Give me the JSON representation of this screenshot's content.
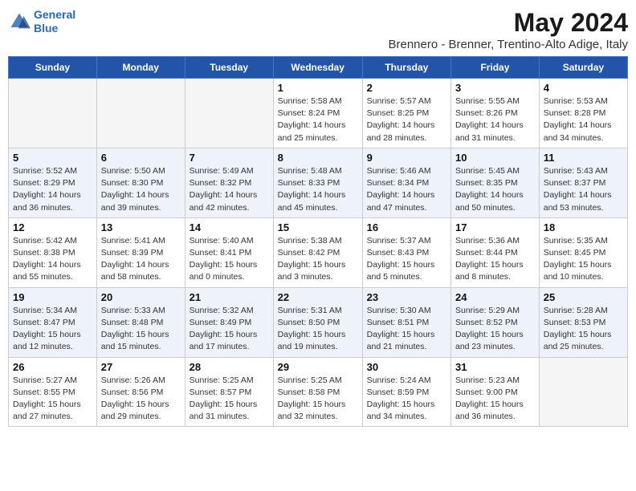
{
  "header": {
    "logo_line1": "General",
    "logo_line2": "Blue",
    "month_year": "May 2024",
    "location": "Brennero - Brenner, Trentino-Alto Adige, Italy"
  },
  "weekdays": [
    "Sunday",
    "Monday",
    "Tuesday",
    "Wednesday",
    "Thursday",
    "Friday",
    "Saturday"
  ],
  "weeks": [
    [
      {
        "day": "",
        "info": ""
      },
      {
        "day": "",
        "info": ""
      },
      {
        "day": "",
        "info": ""
      },
      {
        "day": "1",
        "info": "Sunrise: 5:58 AM\nSunset: 8:24 PM\nDaylight: 14 hours\nand 25 minutes."
      },
      {
        "day": "2",
        "info": "Sunrise: 5:57 AM\nSunset: 8:25 PM\nDaylight: 14 hours\nand 28 minutes."
      },
      {
        "day": "3",
        "info": "Sunrise: 5:55 AM\nSunset: 8:26 PM\nDaylight: 14 hours\nand 31 minutes."
      },
      {
        "day": "4",
        "info": "Sunrise: 5:53 AM\nSunset: 8:28 PM\nDaylight: 14 hours\nand 34 minutes."
      }
    ],
    [
      {
        "day": "5",
        "info": "Sunrise: 5:52 AM\nSunset: 8:29 PM\nDaylight: 14 hours\nand 36 minutes."
      },
      {
        "day": "6",
        "info": "Sunrise: 5:50 AM\nSunset: 8:30 PM\nDaylight: 14 hours\nand 39 minutes."
      },
      {
        "day": "7",
        "info": "Sunrise: 5:49 AM\nSunset: 8:32 PM\nDaylight: 14 hours\nand 42 minutes."
      },
      {
        "day": "8",
        "info": "Sunrise: 5:48 AM\nSunset: 8:33 PM\nDaylight: 14 hours\nand 45 minutes."
      },
      {
        "day": "9",
        "info": "Sunrise: 5:46 AM\nSunset: 8:34 PM\nDaylight: 14 hours\nand 47 minutes."
      },
      {
        "day": "10",
        "info": "Sunrise: 5:45 AM\nSunset: 8:35 PM\nDaylight: 14 hours\nand 50 minutes."
      },
      {
        "day": "11",
        "info": "Sunrise: 5:43 AM\nSunset: 8:37 PM\nDaylight: 14 hours\nand 53 minutes."
      }
    ],
    [
      {
        "day": "12",
        "info": "Sunrise: 5:42 AM\nSunset: 8:38 PM\nDaylight: 14 hours\nand 55 minutes."
      },
      {
        "day": "13",
        "info": "Sunrise: 5:41 AM\nSunset: 8:39 PM\nDaylight: 14 hours\nand 58 minutes."
      },
      {
        "day": "14",
        "info": "Sunrise: 5:40 AM\nSunset: 8:41 PM\nDaylight: 15 hours\nand 0 minutes."
      },
      {
        "day": "15",
        "info": "Sunrise: 5:38 AM\nSunset: 8:42 PM\nDaylight: 15 hours\nand 3 minutes."
      },
      {
        "day": "16",
        "info": "Sunrise: 5:37 AM\nSunset: 8:43 PM\nDaylight: 15 hours\nand 5 minutes."
      },
      {
        "day": "17",
        "info": "Sunrise: 5:36 AM\nSunset: 8:44 PM\nDaylight: 15 hours\nand 8 minutes."
      },
      {
        "day": "18",
        "info": "Sunrise: 5:35 AM\nSunset: 8:45 PM\nDaylight: 15 hours\nand 10 minutes."
      }
    ],
    [
      {
        "day": "19",
        "info": "Sunrise: 5:34 AM\nSunset: 8:47 PM\nDaylight: 15 hours\nand 12 minutes."
      },
      {
        "day": "20",
        "info": "Sunrise: 5:33 AM\nSunset: 8:48 PM\nDaylight: 15 hours\nand 15 minutes."
      },
      {
        "day": "21",
        "info": "Sunrise: 5:32 AM\nSunset: 8:49 PM\nDaylight: 15 hours\nand 17 minutes."
      },
      {
        "day": "22",
        "info": "Sunrise: 5:31 AM\nSunset: 8:50 PM\nDaylight: 15 hours\nand 19 minutes."
      },
      {
        "day": "23",
        "info": "Sunrise: 5:30 AM\nSunset: 8:51 PM\nDaylight: 15 hours\nand 21 minutes."
      },
      {
        "day": "24",
        "info": "Sunrise: 5:29 AM\nSunset: 8:52 PM\nDaylight: 15 hours\nand 23 minutes."
      },
      {
        "day": "25",
        "info": "Sunrise: 5:28 AM\nSunset: 8:53 PM\nDaylight: 15 hours\nand 25 minutes."
      }
    ],
    [
      {
        "day": "26",
        "info": "Sunrise: 5:27 AM\nSunset: 8:55 PM\nDaylight: 15 hours\nand 27 minutes."
      },
      {
        "day": "27",
        "info": "Sunrise: 5:26 AM\nSunset: 8:56 PM\nDaylight: 15 hours\nand 29 minutes."
      },
      {
        "day": "28",
        "info": "Sunrise: 5:25 AM\nSunset: 8:57 PM\nDaylight: 15 hours\nand 31 minutes."
      },
      {
        "day": "29",
        "info": "Sunrise: 5:25 AM\nSunset: 8:58 PM\nDaylight: 15 hours\nand 32 minutes."
      },
      {
        "day": "30",
        "info": "Sunrise: 5:24 AM\nSunset: 8:59 PM\nDaylight: 15 hours\nand 34 minutes."
      },
      {
        "day": "31",
        "info": "Sunrise: 5:23 AM\nSunset: 9:00 PM\nDaylight: 15 hours\nand 36 minutes."
      },
      {
        "day": "",
        "info": ""
      }
    ]
  ]
}
